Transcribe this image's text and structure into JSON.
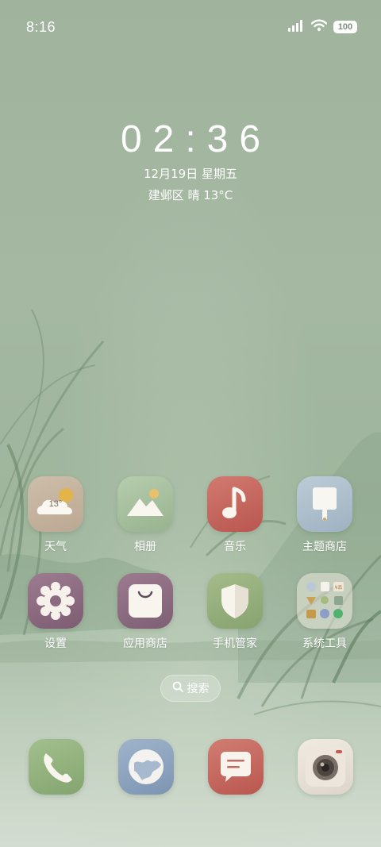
{
  "status_bar": {
    "time": "8:16",
    "battery": "100",
    "icons": [
      "signal-icon",
      "wifi-icon",
      "battery-icon"
    ]
  },
  "clock_widget": {
    "time": "02:36",
    "date": "12月19日 星期五",
    "weather": "建邺区 晴 13°C"
  },
  "apps": [
    {
      "label": "天气",
      "icon": "weather-icon",
      "icon_text": "13°"
    },
    {
      "label": "相册",
      "icon": "gallery-icon"
    },
    {
      "label": "音乐",
      "icon": "music-icon"
    },
    {
      "label": "主题商店",
      "icon": "theme-store-icon"
    },
    {
      "label": "设置",
      "icon": "settings-icon"
    },
    {
      "label": "应用商店",
      "icon": "app-store-icon"
    },
    {
      "label": "手机管家",
      "icon": "phone-manager-icon"
    },
    {
      "label": "系统工具",
      "icon": "system-tools-folder-icon",
      "folder_badge": "¥品"
    }
  ],
  "search": {
    "label": "搜索",
    "icon": "search-icon"
  },
  "dock": [
    {
      "name": "phone",
      "icon": "phone-icon"
    },
    {
      "name": "browser",
      "icon": "browser-icon"
    },
    {
      "name": "messages",
      "icon": "messages-icon"
    },
    {
      "name": "camera",
      "icon": "camera-icon"
    }
  ],
  "colors": {
    "background": "#a4b8a2",
    "weather_bg": "#c9b9a6",
    "gallery_bg": "#a8c2a0",
    "music_bg": "#c9655c",
    "theme_bg": "#a9bccb",
    "settings_bg": "#8a6a80",
    "appstore_bg": "#8c6b80",
    "manager_bg": "#96b07d",
    "phone_bg": "#8fb07a",
    "browser_bg": "#8fa6c0",
    "messages_bg": "#c56a62",
    "camera_bg": "#e8e2da"
  }
}
